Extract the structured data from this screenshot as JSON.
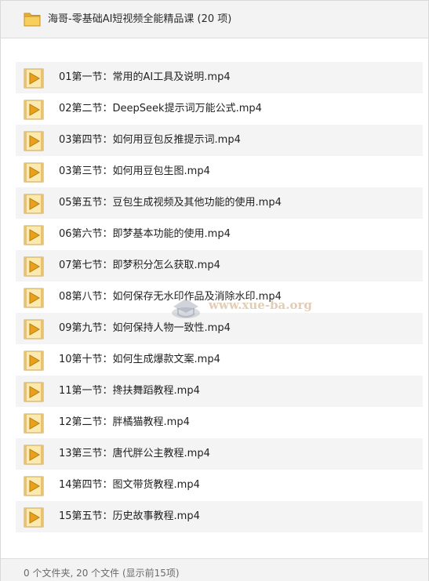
{
  "header": {
    "icon": "folder-icon",
    "title": "海哥-零基础AI短视频全能精品课 (20 项)"
  },
  "files": [
    {
      "name": "01第一节：常用的AI工具及说明.mp4"
    },
    {
      "name": "02第二节：DeepSeek提示词万能公式.mp4"
    },
    {
      "name": "03第四节：如何用豆包反推提示词.mp4"
    },
    {
      "name": "03第三节：如何用豆包生图.mp4"
    },
    {
      "name": "05第五节：豆包生成视频及其他功能的使用.mp4"
    },
    {
      "name": "06第六节：即梦基本功能的使用.mp4"
    },
    {
      "name": "07第七节：即梦积分怎么获取.mp4"
    },
    {
      "name": "08第八节：如何保存无水印作品及消除水印.mp4"
    },
    {
      "name": "09第九节：如何保持人物一致性.mp4"
    },
    {
      "name": "10第十节：如何生成爆款文案.mp4"
    },
    {
      "name": "11第一节：搀扶舞蹈教程.mp4"
    },
    {
      "name": "12第二节：胖橘猫教程.mp4"
    },
    {
      "name": "13第三节：唐代胖公主教程.mp4"
    },
    {
      "name": "14第四节：图文带货教程.mp4"
    },
    {
      "name": "15第五节：历史故事教程.mp4"
    }
  ],
  "file_icon": "video-file-icon",
  "footer": {
    "status": "0 个文件夹, 20 个文件 (显示前15项)"
  },
  "watermark": {
    "text": "www.xue-ba.org"
  },
  "colors": {
    "folder_yellow": "#f2c24f",
    "play_orange": "#e8a21a",
    "header_bg": "#f3f3f3",
    "row_alt_bg": "#f4f4f4"
  }
}
